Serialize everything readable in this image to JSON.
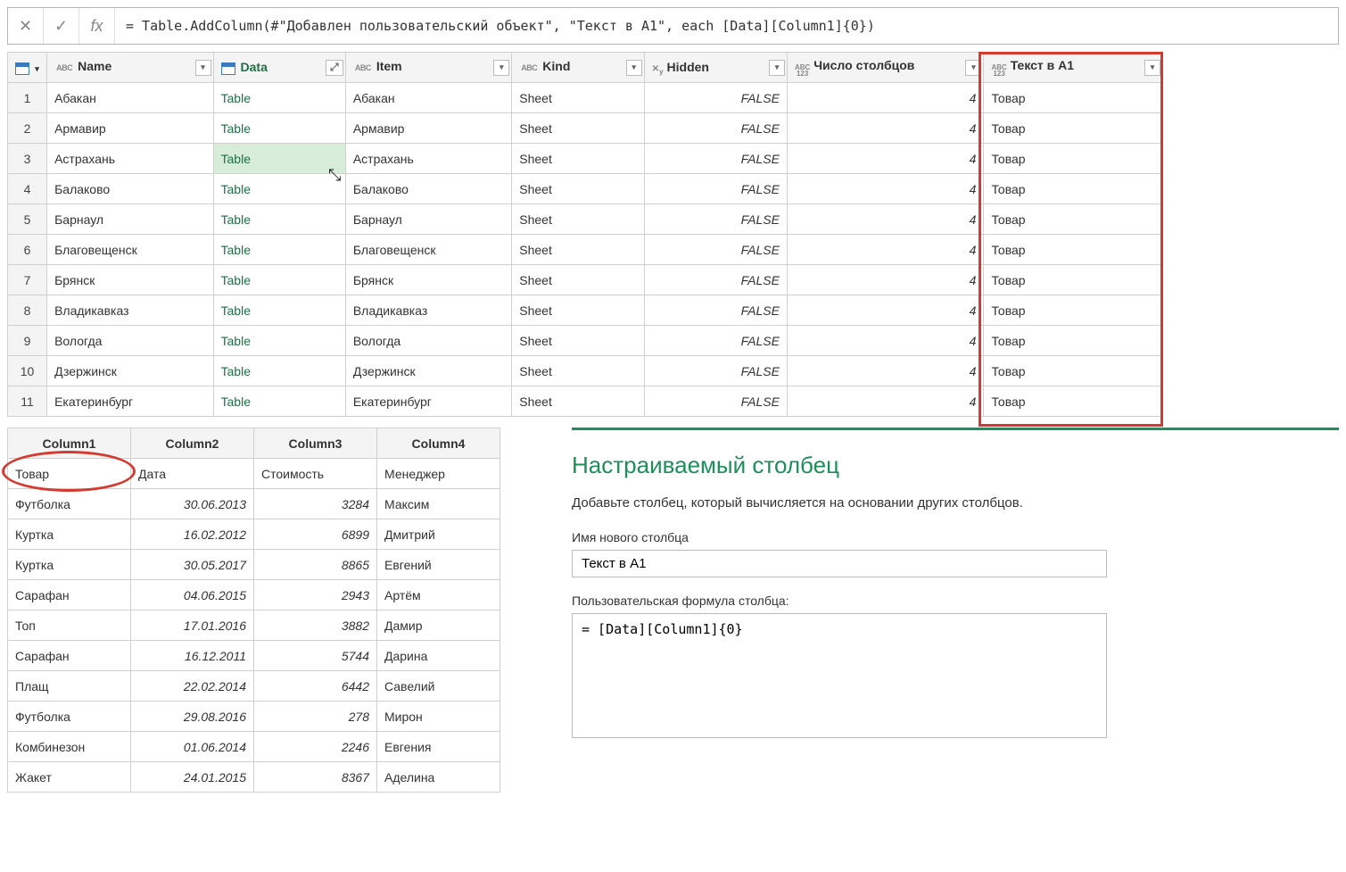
{
  "formula_bar": {
    "formula": "= Table.AddColumn(#\"Добавлен пользовательский объект\", \"Текст в A1\", each [Data][Column1]{0})"
  },
  "main_table": {
    "columns": [
      {
        "name": "Name",
        "type": "abc"
      },
      {
        "name": "Data",
        "type": "table"
      },
      {
        "name": "Item",
        "type": "abc"
      },
      {
        "name": "Kind",
        "type": "abc"
      },
      {
        "name": "Hidden",
        "type": "xy"
      },
      {
        "name": "Число столбцов",
        "type": "abc123"
      },
      {
        "name": "Текст в A1",
        "type": "abc123"
      }
    ],
    "rows": [
      {
        "n": 1,
        "name": "Абакан",
        "data": "Table",
        "item": "Абакан",
        "kind": "Sheet",
        "hidden": "FALSE",
        "cnt": 4,
        "txt": "Товар"
      },
      {
        "n": 2,
        "name": "Армавир",
        "data": "Table",
        "item": "Армавир",
        "kind": "Sheet",
        "hidden": "FALSE",
        "cnt": 4,
        "txt": "Товар"
      },
      {
        "n": 3,
        "name": "Астрахань",
        "data": "Table",
        "item": "Астрахань",
        "kind": "Sheet",
        "hidden": "FALSE",
        "cnt": 4,
        "txt": "Товар",
        "hl": true
      },
      {
        "n": 4,
        "name": "Балаково",
        "data": "Table",
        "item": "Балаково",
        "kind": "Sheet",
        "hidden": "FALSE",
        "cnt": 4,
        "txt": "Товар"
      },
      {
        "n": 5,
        "name": "Барнаул",
        "data": "Table",
        "item": "Барнаул",
        "kind": "Sheet",
        "hidden": "FALSE",
        "cnt": 4,
        "txt": "Товар"
      },
      {
        "n": 6,
        "name": "Благовещенск",
        "data": "Table",
        "item": "Благовещенск",
        "kind": "Sheet",
        "hidden": "FALSE",
        "cnt": 4,
        "txt": "Товар"
      },
      {
        "n": 7,
        "name": "Брянск",
        "data": "Table",
        "item": "Брянск",
        "kind": "Sheet",
        "hidden": "FALSE",
        "cnt": 4,
        "txt": "Товар"
      },
      {
        "n": 8,
        "name": "Владикавказ",
        "data": "Table",
        "item": "Владикавказ",
        "kind": "Sheet",
        "hidden": "FALSE",
        "cnt": 4,
        "txt": "Товар"
      },
      {
        "n": 9,
        "name": "Вологда",
        "data": "Table",
        "item": "Вологда",
        "kind": "Sheet",
        "hidden": "FALSE",
        "cnt": 4,
        "txt": "Товар"
      },
      {
        "n": 10,
        "name": "Дзержинск",
        "data": "Table",
        "item": "Дзержинск",
        "kind": "Sheet",
        "hidden": "FALSE",
        "cnt": 4,
        "txt": "Товар"
      },
      {
        "n": 11,
        "name": "Екатеринбург",
        "data": "Table",
        "item": "Екатеринбург",
        "kind": "Sheet",
        "hidden": "FALSE",
        "cnt": 4,
        "txt": "Товар"
      }
    ]
  },
  "preview_table": {
    "headers": [
      "Column1",
      "Column2",
      "Column3",
      "Column4"
    ],
    "rows": [
      [
        "Товар",
        "Дата",
        "Стоимость",
        "Менеджер"
      ],
      [
        "Футболка",
        "30.06.2013",
        "3284",
        "Максим"
      ],
      [
        "Куртка",
        "16.02.2012",
        "6899",
        "Дмитрий"
      ],
      [
        "Куртка",
        "30.05.2017",
        "8865",
        "Евгений"
      ],
      [
        "Сарафан",
        "04.06.2015",
        "2943",
        "Артём"
      ],
      [
        "Топ",
        "17.01.2016",
        "3882",
        "Дамир"
      ],
      [
        "Сарафан",
        "16.12.2011",
        "5744",
        "Дарина"
      ],
      [
        "Плащ",
        "22.02.2014",
        "6442",
        "Савелий"
      ],
      [
        "Футболка",
        "29.08.2016",
        "278",
        "Мирон"
      ],
      [
        "Комбинезон",
        "01.06.2014",
        "2246",
        "Евгения"
      ],
      [
        "Жакет",
        "24.01.2015",
        "8367",
        "Аделина"
      ]
    ]
  },
  "custom_column": {
    "title": "Настраиваемый столбец",
    "desc": "Добавьте столбец, который вычисляется на основании других столбцов.",
    "name_label": "Имя нового столбца",
    "name_value": "Текст в A1",
    "formula_label": "Пользовательская формула столбца:",
    "formula_value": "= [Data][Column1]{0}"
  }
}
